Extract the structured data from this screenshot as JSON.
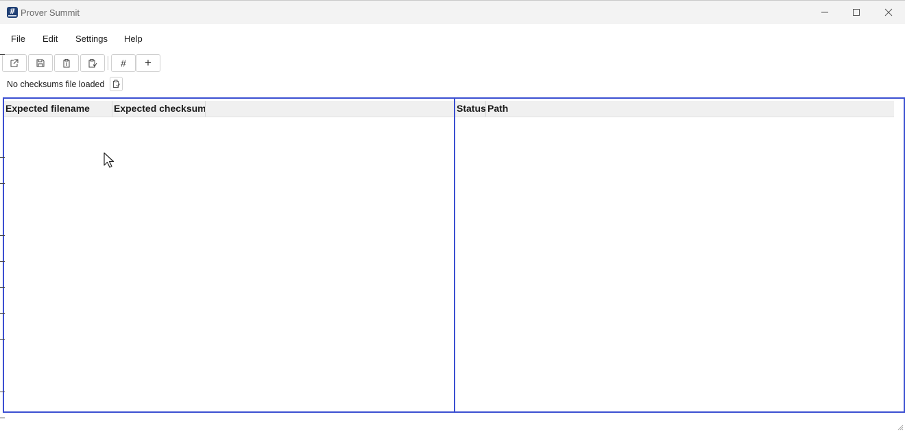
{
  "window": {
    "title": "Prover Summit",
    "app_icon_glyph": "#",
    "controls": {
      "minimize": "minimize-icon",
      "maximize": "maximize-icon",
      "close": "close-icon"
    }
  },
  "menu": {
    "items": [
      "File",
      "Edit",
      "Settings",
      "Help"
    ]
  },
  "toolbar": {
    "buttons": [
      {
        "name": "open-external-icon"
      },
      {
        "name": "save-icon"
      },
      {
        "name": "copy-icon"
      },
      {
        "name": "paste-icon"
      },
      {
        "name": "hash-icon",
        "glyph": "#"
      },
      {
        "name": "add-icon",
        "glyph": "+"
      }
    ]
  },
  "status": {
    "text": "No checksums file loaded"
  },
  "left_table": {
    "columns": [
      "Expected filename",
      "Expected checksum"
    ]
  },
  "right_table": {
    "columns": [
      "Status",
      "Path"
    ]
  },
  "colors": {
    "panel_border": "#3b4fd1",
    "titlebar_bg": "#f3f3f3",
    "header_bg": "#f0f0f0"
  }
}
